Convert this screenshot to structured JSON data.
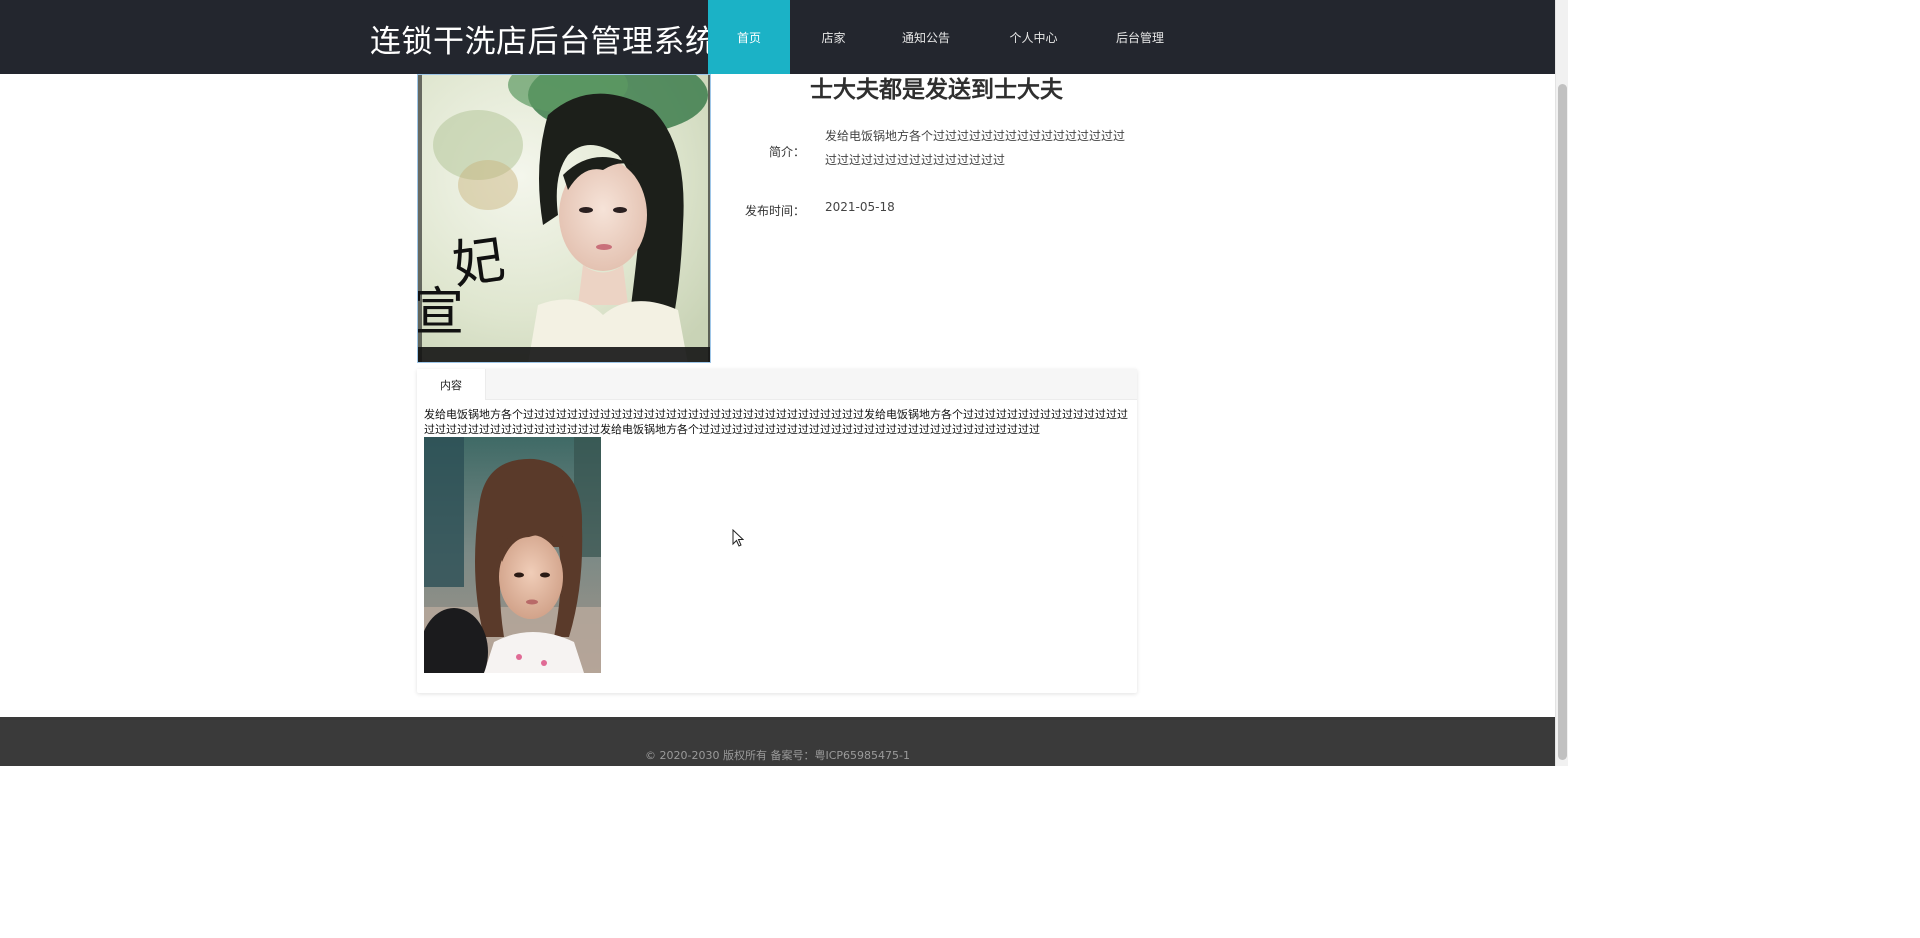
{
  "header": {
    "brand": "连锁干洗店后台管理系统",
    "nav": [
      {
        "label": "首页",
        "active": true
      },
      {
        "label": "店家",
        "active": false
      },
      {
        "label": "通知公告",
        "active": false
      },
      {
        "label": "个人中心",
        "active": false
      },
      {
        "label": "后台管理",
        "active": false
      }
    ]
  },
  "detail": {
    "title": "士大夫都是发送到士大夫",
    "intro_label": "简介：",
    "intro_value": "发给电饭锅地方各个过过过过过过过过过过过过过过过过过过过过过过过过过过过过过过过",
    "date_label": "发布时间：",
    "date_value": "2021-05-18"
  },
  "tabs": {
    "active_label": "内容",
    "content_text": "发给电饭锅地方各个过过过过过过过过过过过过过过过过过过过过过过过过过过过过过过过发给电饭锅地方各个过过过过过过过过过过过过过过过过过过过过过过过过过过过过过过过发给电饭锅地方各个过过过过过过过过过过过过过过过过过过过过过过过过过过过过过过过"
  },
  "footer": {
    "copyright": "© 2020-2030 版权所有 备案号：粤ICP65985475-1"
  },
  "colors": {
    "header_bg": "#23262e",
    "nav_active_bg": "#1bb2c6",
    "footer_bg": "#3a3a3a"
  }
}
